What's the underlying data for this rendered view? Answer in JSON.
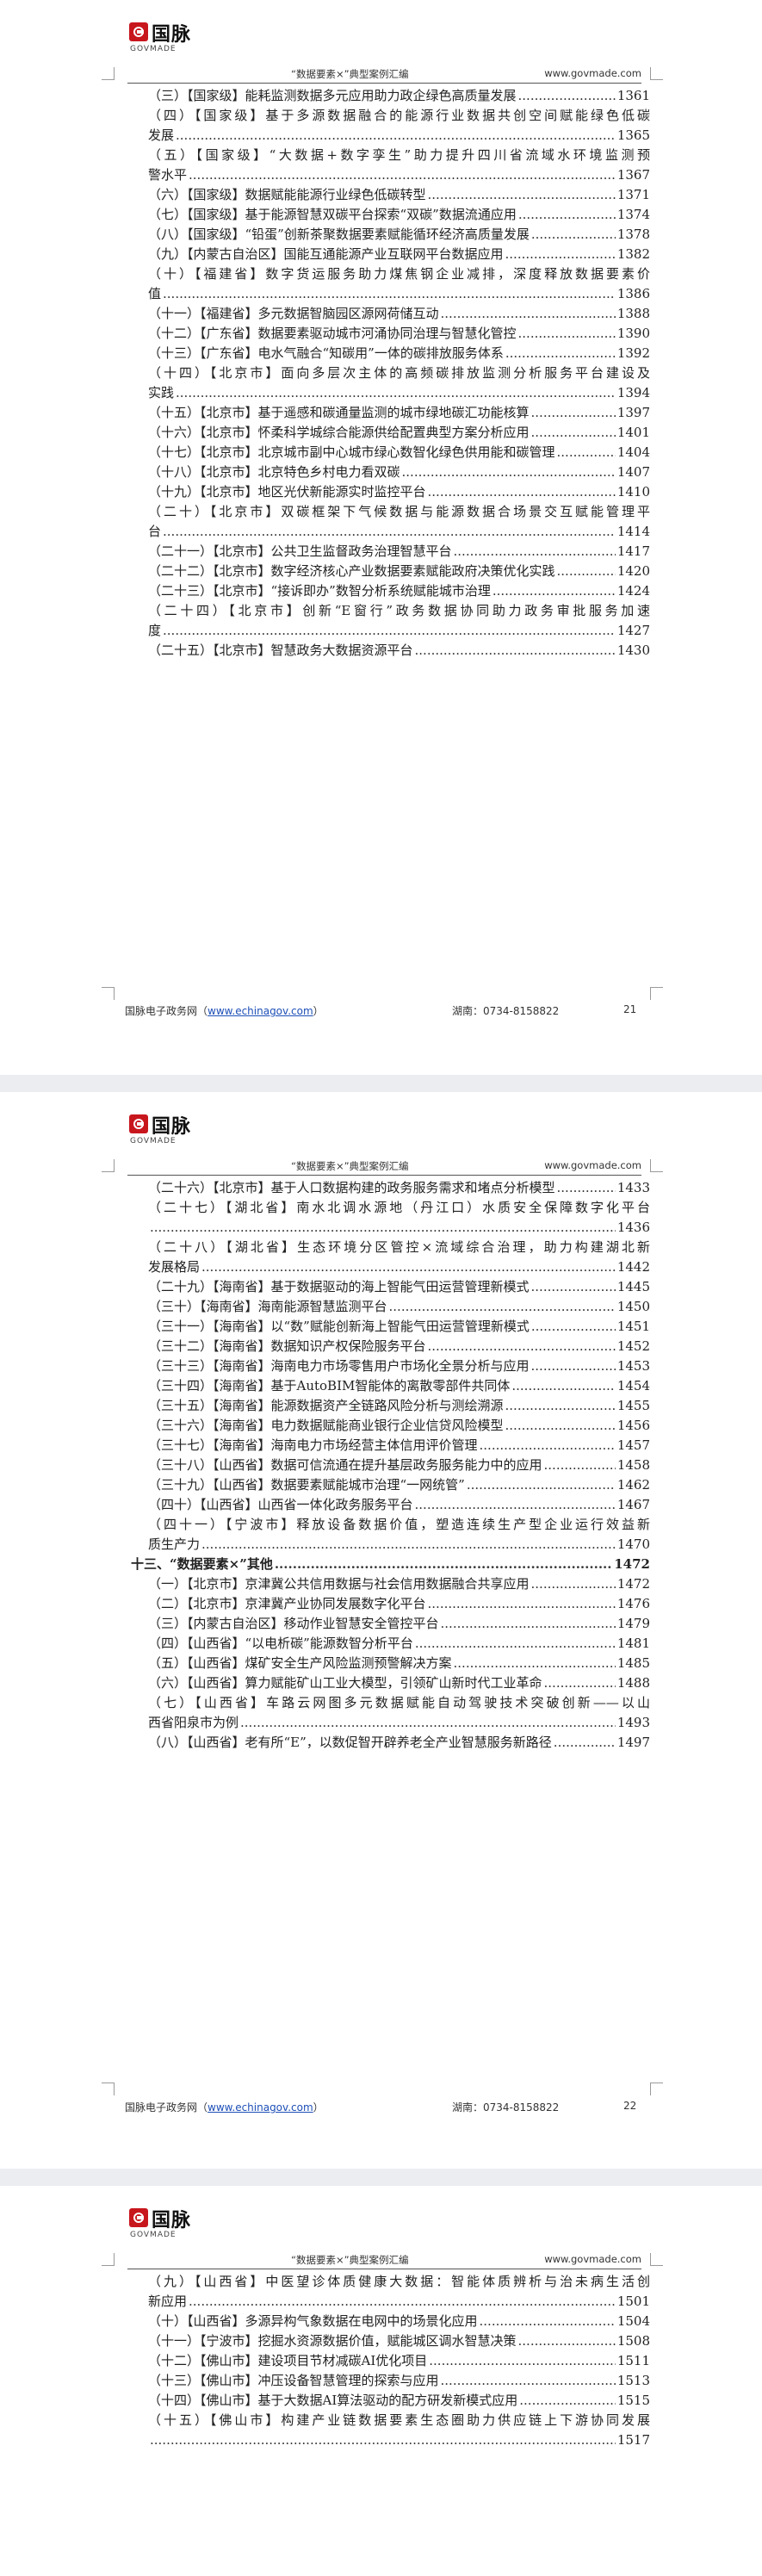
{
  "header": {
    "logo_text": "国脉",
    "logo_sub": "GOVMADE",
    "title": "“数据要素×”典型案例汇编",
    "site": "www.govmade.com"
  },
  "footer": {
    "org": "国脉电子政务网",
    "link": "www.echinagov.com",
    "phone": "湖南：0734-8158822"
  },
  "pages": [
    {
      "number": "21",
      "entries": [
        {
          "text": "（三）【国家级】能耗监测数据多元应用助力政企绿色高质量发展",
          "page": "1361"
        },
        {
          "text": "（四）【国家级】基于多源数据融合的能源行业数据共创空间赋能绿色低碳",
          "cont": "发展",
          "page": "1365"
        },
        {
          "text": "（五）【国家级】“大数据+数字孪生”助力提升四川省流域水环境监测预",
          "cont": "警水平",
          "page": "1367"
        },
        {
          "text": "（六）【国家级】数据赋能能源行业绿色低碳转型",
          "page": "1371"
        },
        {
          "text": "（七）【国家级】基于能源智慧双碳平台探索“双碳”数据流通应用",
          "page": "1374"
        },
        {
          "text": "（八）【国家级】“铅蛋”创新茶聚数据要素赋能循环经济高质量发展",
          "page": "1378"
        },
        {
          "text": "（九）【内蒙古自治区】国能互通能源产业互联网平台数据应用",
          "page": "1382"
        },
        {
          "text": "（十）【福建省】数字货运服务助力煤焦钢企业减排，深度释放数据要素价",
          "cont": "值",
          "page": "1386"
        },
        {
          "text": "（十一）【福建省】多元数据智脑园区源网荷储互动",
          "page": "1388"
        },
        {
          "text": "（十二）【广东省】数据要素驱动城市河涌协同治理与智慧化管控",
          "page": "1390"
        },
        {
          "text": "（十三）【广东省】电水气融合“知碳用”一体的碳排放服务体系",
          "page": "1392"
        },
        {
          "text": "（十四）【北京市】面向多层次主体的高频碳排放监测分析服务平台建设及",
          "cont": "实践",
          "page": "1394"
        },
        {
          "text": "（十五）【北京市】基于遥感和碳通量监测的城市绿地碳汇功能核算",
          "page": "1397"
        },
        {
          "text": "（十六）【北京市】怀柔科学城综合能源供给配置典型方案分析应用",
          "page": "1401"
        },
        {
          "text": "（十七）【北京市】北京城市副中心城市绿心数智化绿色供用能和碳管理",
          "page": "1404"
        },
        {
          "text": "（十八）【北京市】北京特色乡村电力看双碳",
          "page": "1407"
        },
        {
          "text": "（十九）【北京市】地区光伏新能源实时监控平台",
          "page": "1410"
        },
        {
          "text": "（二十）【北京市】双碳框架下气候数据与能源数据合场景交互赋能管理平",
          "cont": "台",
          "page": "1414"
        },
        {
          "text": "（二十一）【北京市】公共卫生监督政务治理智慧平台",
          "page": "1417"
        },
        {
          "text": "（二十二）【北京市】数字经济核心产业数据要素赋能政府决策优化实践",
          "page": "1420"
        },
        {
          "text": "（二十三）【北京市】“接诉即办”数智分析系统赋能城市治理",
          "page": "1424"
        },
        {
          "text": "（二十四）【北京市】创新“E窗行”政务数据协同助力政务审批服务加速",
          "cont": "度",
          "page": "1427"
        },
        {
          "text": "（二十五）【北京市】智慧政务大数据资源平台",
          "page": "1430"
        }
      ]
    },
    {
      "number": "22",
      "entries": [
        {
          "text": "（二十六）【北京市】基于人口数据构建的政务服务需求和堵点分析模型",
          "page": "1433"
        },
        {
          "text": "（二十七）【湖北省】南水北调水源地（丹江口）水质安全保障数字化平台",
          "cont": "",
          "page": "1436"
        },
        {
          "text": "（二十八）【湖北省】生态环境分区管控×流域综合治理，助力构建湖北新",
          "cont": "发展格局",
          "page": "1442"
        },
        {
          "text": "（二十九）【海南省】基于数据驱动的海上智能气田运营管理新模式",
          "page": "1445"
        },
        {
          "text": "（三十）【海南省】海南能源智慧监测平台",
          "page": "1450"
        },
        {
          "text": "（三十一）【海南省】以“数”赋能创新海上智能气田运营管理新模式",
          "page": "1451"
        },
        {
          "text": "（三十二）【海南省】数据知识产权保险服务平台",
          "page": "1452"
        },
        {
          "text": "（三十三）【海南省】海南电力市场零售用户市场化全景分析与应用",
          "page": "1453"
        },
        {
          "text": "（三十四）【海南省】基于AutoBIM智能体的离散零部件共同体",
          "page": "1454"
        },
        {
          "text": "（三十五）【海南省】能源数据资产全链路风险分析与测绘溯源",
          "page": "1455"
        },
        {
          "text": "（三十六）【海南省】电力数据赋能商业银行企业信贷风险模型",
          "page": "1456"
        },
        {
          "text": "（三十七）【海南省】海南电力市场经营主体信用评价管理",
          "page": "1457"
        },
        {
          "text": "（三十八）【山西省】数据可信流通在提升基层政务服务能力中的应用",
          "page": "1458"
        },
        {
          "text": "（三十九）【山西省】数据要素赋能城市治理“一网统管”",
          "page": "1462"
        },
        {
          "text": "（四十）【山西省】山西省一体化政务服务平台",
          "page": "1467"
        },
        {
          "text": "（四十一）【宁波市】释放设备数据价值，塑造连续生产型企业运行效益新",
          "cont": "质生产力",
          "page": "1470"
        },
        {
          "text": "十三、“数据要素×”其他",
          "page": "1472",
          "top": true
        },
        {
          "text": "（一）【北京市】京津冀公共信用数据与社会信用数据融合共享应用",
          "page": "1472"
        },
        {
          "text": "（二）【北京市】京津冀产业协同发展数字化平台",
          "page": "1476"
        },
        {
          "text": "（三）【内蒙古自治区】移动作业智慧安全管控平台",
          "page": "1479"
        },
        {
          "text": "（四）【山西省】“以电析碳”能源数智分析平台",
          "page": "1481"
        },
        {
          "text": "（五）【山西省】煤矿安全生产风险监测预警解决方案",
          "page": "1485"
        },
        {
          "text": "（六）【山西省】算力赋能矿山工业大模型，引领矿山新时代工业革命",
          "page": "1488"
        },
        {
          "text": "（七）【山西省】车路云网图多元数据赋能自动驾驶技术突破创新——以山",
          "cont": "西省阳泉市为例",
          "page": "1493"
        },
        {
          "text": "（八）【山西省】老有所“E”，以数促智开辟养老全产业智慧服务新路径",
          "page": "1497"
        }
      ]
    },
    {
      "number": "",
      "entries": [
        {
          "text": "（九）【山西省】中医望诊体质健康大数据：智能体质辨析与治未病生活创",
          "cont": "新应用",
          "page": "1501"
        },
        {
          "text": "（十）【山西省】多源异构气象数据在电网中的场景化应用",
          "page": "1504"
        },
        {
          "text": "（十一）【宁波市】挖掘水资源数据价值，赋能城区调水智慧决策",
          "page": "1508"
        },
        {
          "text": "（十二）【佛山市】建设项目节材减碳AI优化项目",
          "page": "1511"
        },
        {
          "text": "（十三）【佛山市】冲压设备智慧管理的探索与应用",
          "page": "1513"
        },
        {
          "text": "（十四）【佛山市】基于大数据AI算法驱动的配方研发新模式应用",
          "page": "1515"
        },
        {
          "text": "（十五）【佛山市】构建产业链数据要素生态圈助力供应链上下游协同发展",
          "cont": "",
          "page": "1517"
        }
      ]
    }
  ]
}
